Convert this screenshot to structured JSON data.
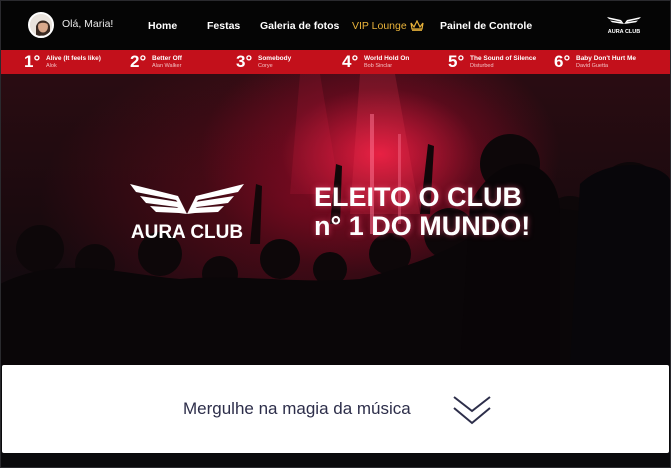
{
  "user": {
    "greeting": "Olá, Maria!"
  },
  "nav": {
    "items": [
      {
        "label": "Home"
      },
      {
        "label": "Festas"
      },
      {
        "label": "Galeria de fotos"
      },
      {
        "label": "VIP Lounge"
      },
      {
        "label": "Painel de Controle"
      }
    ],
    "logo_text": "AURA CLUB",
    "vip_color": "#e9b33a"
  },
  "chart": {
    "accent": "#c3101b",
    "ranks": [
      {
        "pos": "1°",
        "song": "Alive (It feels like)",
        "artist": "Alok"
      },
      {
        "pos": "2°",
        "song": "Better Off",
        "artist": "Alan Walker"
      },
      {
        "pos": "3°",
        "song": "Somebody",
        "artist": "Corye"
      },
      {
        "pos": "4°",
        "song": "World Hold On",
        "artist": "Bob Sinclar"
      },
      {
        "pos": "5°",
        "song": "The Sound of Silence",
        "artist": "Disturbed"
      },
      {
        "pos": "6°",
        "song": "Baby Don't Hurt Me",
        "artist": "David Guetta"
      }
    ]
  },
  "hero": {
    "brand": "AURA CLUB",
    "headline_line1": "ELEITO O CLUB",
    "headline_line2": "n° 1 DO MUNDO!"
  },
  "cta": {
    "label": "Mergulhe na magia da música",
    "icon": "chevron-down-icon",
    "text_color": "#2d2e4a"
  }
}
